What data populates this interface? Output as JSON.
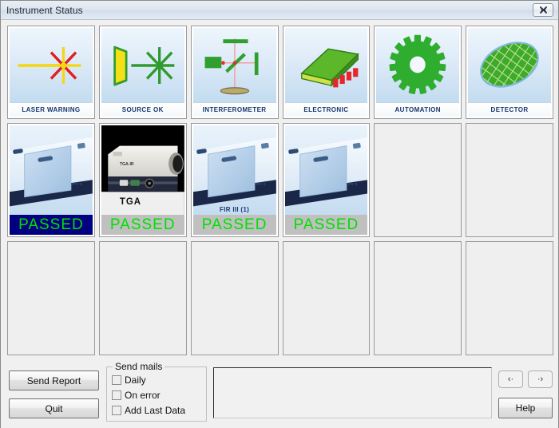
{
  "window": {
    "title": "Instrument Status",
    "close_icon": "close-icon",
    "close_glyph": "✕"
  },
  "colors": {
    "label_text": "#15356e",
    "status_pass_text": "#00e000",
    "status_selected_bg": "#000080",
    "status_normal_bg": "#c0c0c0",
    "laser_warning_accent": "#e8222a",
    "ok_green": "#2aa12a"
  },
  "status_tiles": [
    {
      "label": "LASER WARNING",
      "icon": "laser-burst-icon",
      "state": "warning"
    },
    {
      "label": "SOURCE OK",
      "icon": "source-beam-icon",
      "state": "ok"
    },
    {
      "label": "INTERFEROMETER",
      "icon": "interferometer-icon",
      "state": "ok"
    },
    {
      "label": "ELECTRONIC",
      "icon": "electronic-board-icon",
      "state": "ok"
    },
    {
      "label": "AUTOMATION",
      "icon": "gear-icon",
      "state": "ok"
    },
    {
      "label": "DETECTOR",
      "icon": "detector-mesh-icon",
      "state": "ok"
    }
  ],
  "instruments": [
    {
      "caption": "",
      "status": "PASSED",
      "selected": true,
      "photo": "spectrometer-photo"
    },
    {
      "caption": "TGA",
      "status": "PASSED",
      "selected": false,
      "photo": "tga-photo"
    },
    {
      "caption": "FIR III (1)",
      "status": "PASSED",
      "selected": false,
      "photo": "spectrometer-photo"
    },
    {
      "caption": "",
      "status": "PASSED",
      "selected": false,
      "photo": "spectrometer-photo"
    },
    {
      "caption": "",
      "status": "",
      "selected": false,
      "photo": ""
    },
    {
      "caption": "",
      "status": "",
      "selected": false,
      "photo": ""
    }
  ],
  "empty_row_cells": 6,
  "bottom": {
    "send_report_label": "Send Report",
    "quit_label": "Quit",
    "group_title": "Send mails",
    "checkboxes": [
      {
        "label": "Daily",
        "checked": false
      },
      {
        "label": "On error",
        "checked": false
      },
      {
        "label": "Add Last Data",
        "checked": false
      }
    ],
    "log_text": "",
    "nav_prev_label": "‹·",
    "nav_next_label": "·›",
    "help_label": "Help"
  }
}
